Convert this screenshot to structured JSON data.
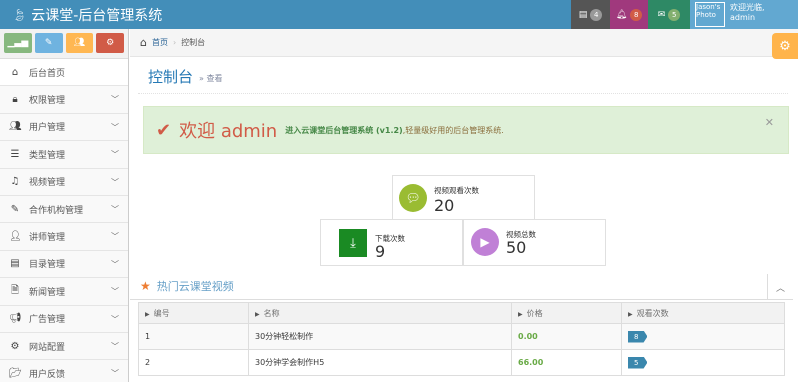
{
  "navbar": {
    "brand": "云课堂-后台管理系统",
    "tasks_count": "4",
    "notifications_count": "8",
    "messages_count": "5",
    "avatar_alt": "Jason's Photo",
    "user_greeting": "欢迎光临,",
    "user_name": "admin"
  },
  "sidebar": {
    "items": [
      {
        "label": "后台首页",
        "icon": "home-icon",
        "glyph": "⌂",
        "chevron": false
      },
      {
        "label": "权限管理",
        "icon": "lock-icon",
        "glyph": "🔒︎",
        "chevron": true
      },
      {
        "label": "用户管理",
        "icon": "users-icon",
        "glyph": "👥︎",
        "chevron": true
      },
      {
        "label": "类型管理",
        "icon": "list-icon",
        "glyph": "☰",
        "chevron": true
      },
      {
        "label": "视频管理",
        "icon": "music-icon",
        "glyph": "♫",
        "chevron": true
      },
      {
        "label": "合作机构管理",
        "icon": "edit-icon",
        "glyph": "✎",
        "chevron": true
      },
      {
        "label": "讲师管理",
        "icon": "user-icon",
        "glyph": "👤︎",
        "chevron": true
      },
      {
        "label": "目录管理",
        "icon": "list-alt-icon",
        "glyph": "▤",
        "chevron": true
      },
      {
        "label": "新闻管理",
        "icon": "file-icon",
        "glyph": "🗎︎",
        "chevron": true
      },
      {
        "label": "广告管理",
        "icon": "bullhorn-icon",
        "glyph": "📢︎",
        "chevron": true
      },
      {
        "label": "网站配置",
        "icon": "cogs-icon",
        "glyph": "⚙",
        "chevron": true
      },
      {
        "label": "用户反馈",
        "icon": "folder-open-icon",
        "glyph": "📂︎",
        "chevron": true
      }
    ]
  },
  "breadcrumb": {
    "home": "首页",
    "current": "控制台"
  },
  "page": {
    "title": "控制台",
    "subtitle": "» 查看"
  },
  "alert": {
    "welcome": "欢迎 admin",
    "desc_bold": "进入云课堂后台管理系统 (v1.2)",
    "desc_rest": ",轻量级好用的后台管理系统."
  },
  "stats": {
    "views_label": "视频观看次数",
    "views_value": "20",
    "downloads_label": "下载次数",
    "downloads_value": "9",
    "videos_label": "视频总数",
    "videos_value": "50"
  },
  "hot": {
    "title": "热门云课堂视频",
    "columns": [
      "编号",
      "名称",
      "价格",
      "观看次数"
    ],
    "rows": [
      {
        "id": "1",
        "name": "30分钟轻松制作",
        "price": "0.00",
        "views": "8"
      },
      {
        "id": "2",
        "name": "30分钟学会制作H5",
        "price": "66.00",
        "views": "5"
      }
    ]
  },
  "colors": {
    "navbar": "#438eb9",
    "accent": "#2679b5",
    "success_bg": "#dff0d8",
    "welcome": "#d15b47"
  }
}
